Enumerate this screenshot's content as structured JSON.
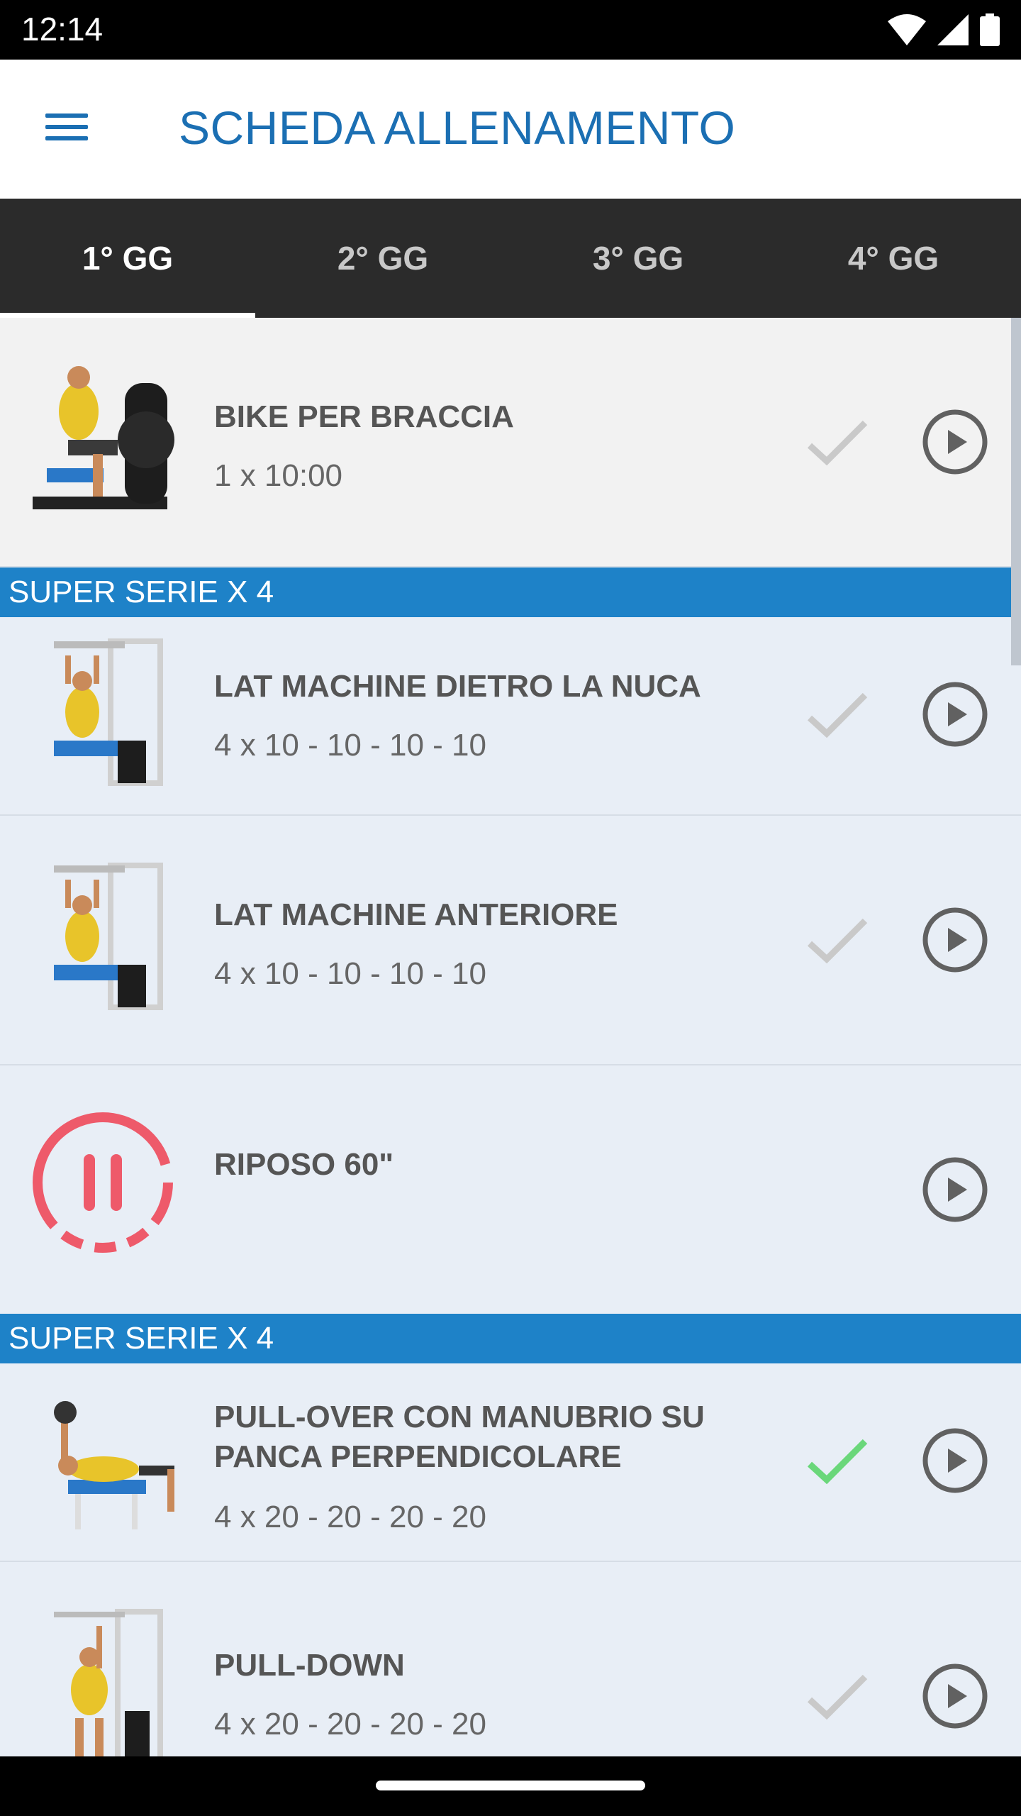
{
  "status_bar": {
    "time": "12:14"
  },
  "app_bar": {
    "title": "SCHEDA ALLENAMENTO"
  },
  "tabs": [
    {
      "label": "1° GG",
      "active": true
    },
    {
      "label": "2° GG",
      "active": false
    },
    {
      "label": "3° GG",
      "active": false
    },
    {
      "label": "4° GG",
      "active": false
    }
  ],
  "exercises": {
    "bike": {
      "name": "BIKE PER BRACCIA",
      "sets": "1 x 10:00",
      "done": false
    },
    "section1": "SUPER SERIE X 4",
    "lat_nuca": {
      "name": "LAT MACHINE DIETRO LA NUCA",
      "sets": "4 x 10 - 10 - 10 - 10",
      "done": false
    },
    "lat_ant": {
      "name": "LAT MACHINE ANTERIORE",
      "sets": "4 x 10 - 10 - 10 - 10",
      "done": false
    },
    "rest": {
      "name": "RIPOSO 60\""
    },
    "section2": "SUPER SERIE X 4",
    "pullover": {
      "name_line1": "PULL-OVER CON MANUBRIO SU",
      "name_line2": "PANCA PERPENDICOLARE",
      "sets": "4 x 20 - 20 - 20 - 20",
      "done": true
    },
    "pulldown": {
      "name": "PULL-DOWN",
      "sets": "4 x 20 - 20 - 20 - 20",
      "done": false
    }
  },
  "colors": {
    "accent": "#1b6fb3",
    "section_header": "#1e82c8",
    "check_done": "#6ad77a",
    "check_pending": "#c9c9c9",
    "rest_icon": "#ee5a6a"
  }
}
